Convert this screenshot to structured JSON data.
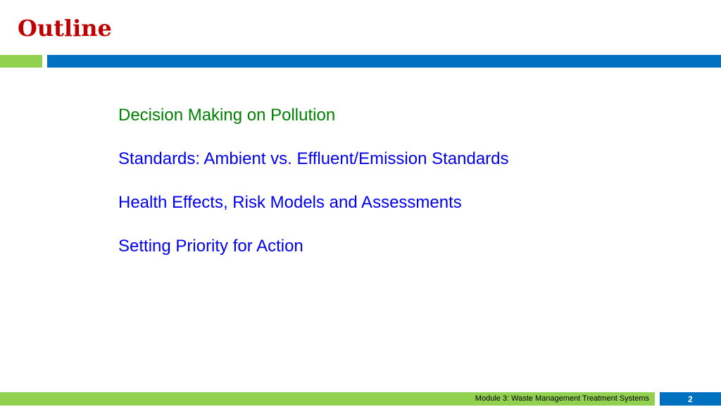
{
  "slide": {
    "title": "Outline",
    "items": [
      {
        "label": "Decision Making on Pollution",
        "active": true
      },
      {
        "label": "Standards: Ambient vs. Effluent/Emission Standards",
        "active": false
      },
      {
        "label": "Health Effects, Risk Models and Assessments",
        "active": false
      },
      {
        "label": "Setting Priority for Action",
        "active": false
      }
    ]
  },
  "footer": {
    "module_text": "Module 3: Waste Management Treatment Systems",
    "page_number": "2"
  },
  "colors": {
    "title": "#c00000",
    "accent_green": "#92d050",
    "accent_blue": "#0070c0",
    "active_item": "#008000",
    "item": "#0000ee"
  }
}
